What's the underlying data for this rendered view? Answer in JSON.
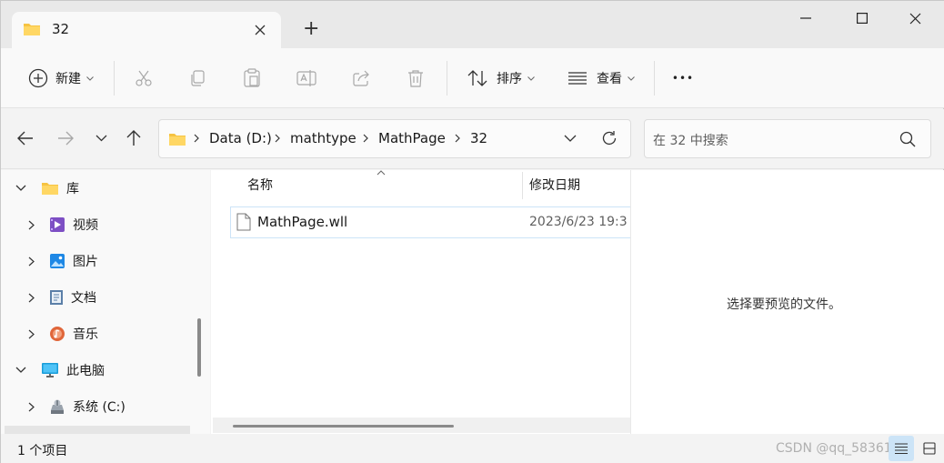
{
  "tab": {
    "title": "32",
    "new_tab_symbol": "+"
  },
  "toolbar": {
    "new_label": "新建",
    "sort_label": "排序",
    "view_label": "查看",
    "more_symbol": "•••"
  },
  "address": {
    "crumbs": [
      "Data (D:)",
      "mathtype",
      "MathPage",
      "32"
    ]
  },
  "search": {
    "placeholder": "在 32 中搜索"
  },
  "nav": {
    "items": [
      {
        "label": "库",
        "icon": "library-folder-icon",
        "expanded": true
      },
      {
        "label": "视频",
        "icon": "videos-icon"
      },
      {
        "label": "图片",
        "icon": "pictures-icon"
      },
      {
        "label": "文档",
        "icon": "documents-icon"
      },
      {
        "label": "音乐",
        "icon": "music-icon"
      },
      {
        "label": "此电脑",
        "icon": "this-pc-icon",
        "expanded": true
      },
      {
        "label": "系统 (C:)",
        "icon": "system-drive-icon"
      }
    ]
  },
  "files": {
    "columns": [
      "名称",
      "修改日期"
    ],
    "rows": [
      {
        "name": "MathPage.wll",
        "modified": "2023/6/23 19:3"
      }
    ]
  },
  "preview": {
    "message": "选择要预览的文件。"
  },
  "status": {
    "count": "1 个项目"
  },
  "watermark": "CSDN @qq_5836179",
  "colors": {
    "folder": "#f6c342",
    "accent": "#0067c0",
    "selection_border": "#cce4f7"
  }
}
